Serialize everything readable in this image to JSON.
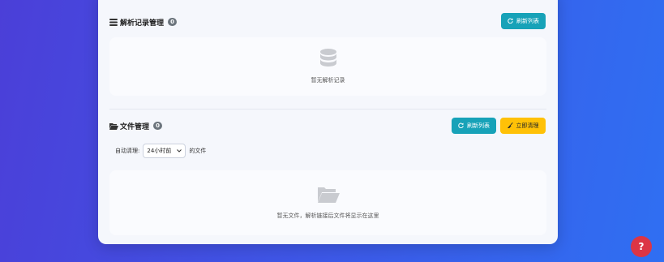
{
  "records": {
    "title": "解析记录管理",
    "count": "0",
    "refresh_label": "刷新列表",
    "empty_text": "暂无解析记录",
    "icons": {
      "title": "list-icon",
      "refresh": "refresh-icon",
      "empty": "database-icon"
    }
  },
  "files": {
    "title": "文件管理",
    "count": "0",
    "refresh_label": "刷新列表",
    "clean_label": "立即清理",
    "cleanup_prefix": "自动清理:",
    "cleanup_select_value": "24小时前",
    "cleanup_suffix": "的文件",
    "empty_text": "暂无文件，解析链接后文件将显示在这里",
    "icons": {
      "title": "folder-open-icon",
      "refresh": "refresh-icon",
      "clean": "broom-icon",
      "empty": "folder-icon"
    }
  },
  "help": {
    "label": "?",
    "icon": "help-icon"
  },
  "colors": {
    "teal": "#17a2b8",
    "yellow": "#ffc107",
    "red": "#dc3545",
    "badge": "#6c757d"
  }
}
